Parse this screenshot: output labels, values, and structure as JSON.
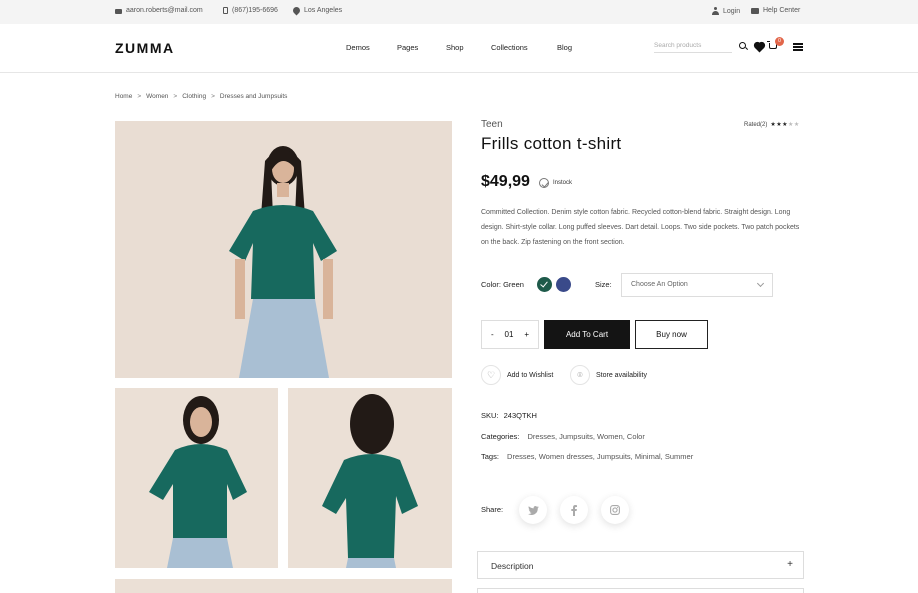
{
  "topbar": {
    "email": "aaron.roberts@mail.com",
    "phone": "(867)195-6696",
    "location": "Los Angeles",
    "login": "Login",
    "help": "Help Center"
  },
  "header": {
    "logo": "ZUMMA",
    "nav": [
      "Demos",
      "Pages",
      "Shop",
      "Collections",
      "Blog"
    ],
    "search_placeholder": "Search products",
    "cart_count": "0"
  },
  "breadcrumb": [
    "Home",
    "Women",
    "Clothing",
    "Dresses and Jumpsuits"
  ],
  "product": {
    "brand": "Teen",
    "rating_label": "Rated(2)",
    "rating": 3,
    "rating_max": 5,
    "title": "Frills cotton t-shirt",
    "price": "$49,99",
    "stock": "Instock",
    "description": "Committed Collection. Denim style cotton fabric. Recycled cotton-blend fabric. Straight design. Long design. Shirt-style collar. Long puffed sleeves. Dart detail. Loops. Two side pockets. Two patch pockets on the back. Zip fastening on the front section.",
    "color_label": "Color: Green",
    "colors": [
      "#1e5a4a",
      "#3a4a8a"
    ],
    "size_label": "Size:",
    "size_placeholder": "Choose An Option",
    "qty_minus": "-",
    "qty": "01",
    "qty_plus": "+",
    "add_to_cart": "Add To Cart",
    "buy_now": "Buy now",
    "wishlist": "Add to Wishlist",
    "store": "Store availability",
    "sku_label": "SKU:",
    "sku": "243QTKH",
    "categories_label": "Categories:",
    "categories": "Dresses, Jumpsuits, Women, Color",
    "tags_label": "Tags:",
    "tags": "Dresses, Women dresses, Jumpsuits, Minimal, Summer",
    "share_label": "Share:",
    "share": [
      "twitter-icon",
      "facebook-icon",
      "instagram-icon"
    ],
    "accordion": [
      "Description"
    ]
  },
  "colors": {
    "primary": "#141414",
    "badge": "#e2664a",
    "image_bg": "#e9ddd3",
    "shirt": "#17695e"
  }
}
